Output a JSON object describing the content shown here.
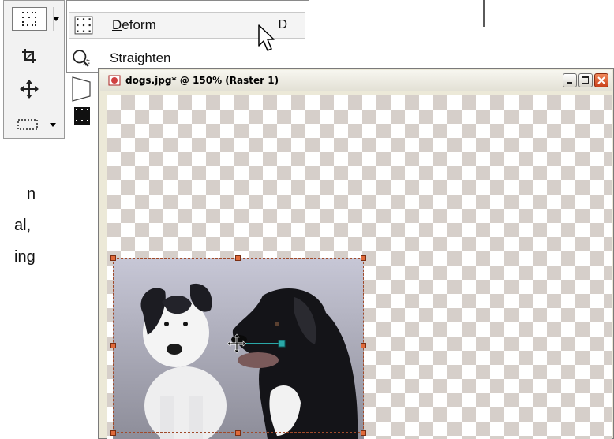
{
  "flyout": {
    "items": [
      {
        "label_u": "D",
        "label_rest": "eform",
        "shortcut": "D",
        "icon": "deform-icon",
        "highlighted": true
      },
      {
        "label_u": "",
        "label_rest": "Straighten",
        "shortcut": "",
        "icon": "straighten-icon",
        "highlighted": false
      }
    ]
  },
  "palette": {
    "tools": [
      "deform-tool-icon",
      "crop-tool-icon",
      "move-tool-icon",
      "selection-tool-icon"
    ]
  },
  "partial_text": {
    "lines": [
      "n",
      "al,",
      "ing"
    ]
  },
  "window": {
    "title": "dogs.jpg* @ 150% (Raster 1)",
    "buttons": [
      "minimize",
      "maximize",
      "close"
    ]
  },
  "colors": {
    "checker_dark": "#d6cfca",
    "selection": "#a04a2a",
    "handle": "#e06a3a",
    "pivot_line": "#2aa8a8"
  }
}
